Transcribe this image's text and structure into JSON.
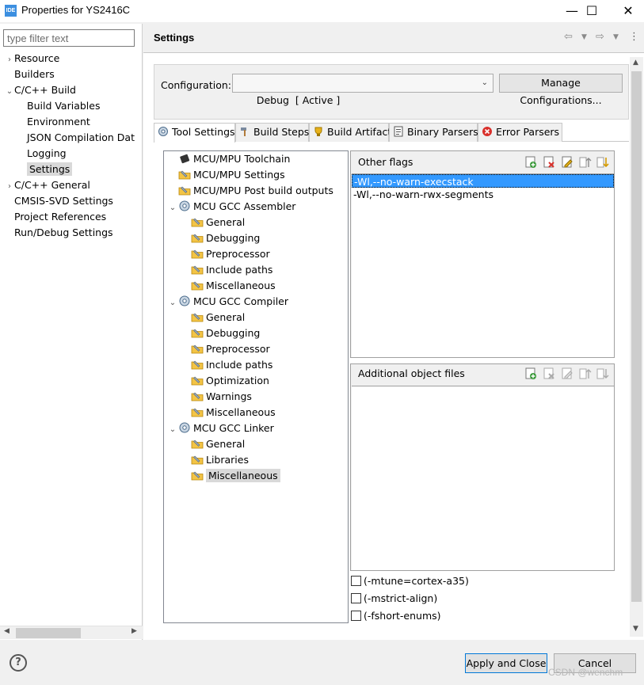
{
  "window": {
    "app_badge": "IDE",
    "title": "Properties for YS2416C",
    "minimize": "—",
    "maximize": "☐",
    "close": "✕"
  },
  "filter": {
    "placeholder": "type filter text"
  },
  "nav": {
    "items": [
      {
        "label": "Resource",
        "twist": "›",
        "level": 0
      },
      {
        "label": "Builders",
        "twist": "",
        "level": 0
      },
      {
        "label": "C/C++ Build",
        "twist": "⌄",
        "level": 0
      },
      {
        "label": "Build Variables",
        "twist": "",
        "level": 1
      },
      {
        "label": "Environment",
        "twist": "",
        "level": 1
      },
      {
        "label": "JSON Compilation Dat",
        "twist": "",
        "level": 1
      },
      {
        "label": "Logging",
        "twist": "",
        "level": 1
      },
      {
        "label": "Settings",
        "twist": "",
        "level": 1,
        "selected": true
      },
      {
        "label": "C/C++ General",
        "twist": "›",
        "level": 0
      },
      {
        "label": "CMSIS-SVD Settings",
        "twist": "",
        "level": 0
      },
      {
        "label": "Project References",
        "twist": "",
        "level": 0
      },
      {
        "label": "Run/Debug Settings",
        "twist": "",
        "level": 0
      }
    ]
  },
  "header": {
    "title": "Settings"
  },
  "config": {
    "label": "Configuration:",
    "selected": "Debug  [ Active ]",
    "manage_label": "Manage Configurations..."
  },
  "tabs": [
    {
      "label": "Tool Settings",
      "active": true
    },
    {
      "label": "Build Steps"
    },
    {
      "label": "Build Artifact"
    },
    {
      "label": "Binary Parsers"
    },
    {
      "label": "Error Parsers"
    }
  ],
  "tree": {
    "items": [
      {
        "label": "MCU/MPU Toolchain",
        "level": 0,
        "icon": "chip-icon"
      },
      {
        "label": "MCU/MPU Settings",
        "level": 0,
        "icon": "settings-folder-icon"
      },
      {
        "label": "MCU/MPU Post build outputs",
        "level": 0,
        "icon": "settings-folder-icon"
      },
      {
        "label": "MCU GCC Assembler",
        "level": 0,
        "icon": "tool-gear-icon",
        "twist": "⌄"
      },
      {
        "label": "General",
        "level": 1,
        "icon": "settings-folder-icon"
      },
      {
        "label": "Debugging",
        "level": 1,
        "icon": "settings-folder-icon"
      },
      {
        "label": "Preprocessor",
        "level": 1,
        "icon": "settings-folder-icon"
      },
      {
        "label": "Include paths",
        "level": 1,
        "icon": "settings-folder-icon"
      },
      {
        "label": "Miscellaneous",
        "level": 1,
        "icon": "settings-folder-icon"
      },
      {
        "label": "MCU GCC Compiler",
        "level": 0,
        "icon": "tool-gear-icon",
        "twist": "⌄"
      },
      {
        "label": "General",
        "level": 1,
        "icon": "settings-folder-icon"
      },
      {
        "label": "Debugging",
        "level": 1,
        "icon": "settings-folder-icon"
      },
      {
        "label": "Preprocessor",
        "level": 1,
        "icon": "settings-folder-icon"
      },
      {
        "label": "Include paths",
        "level": 1,
        "icon": "settings-folder-icon"
      },
      {
        "label": "Optimization",
        "level": 1,
        "icon": "settings-folder-icon"
      },
      {
        "label": "Warnings",
        "level": 1,
        "icon": "settings-folder-icon"
      },
      {
        "label": "Miscellaneous",
        "level": 1,
        "icon": "settings-folder-icon"
      },
      {
        "label": "MCU GCC Linker",
        "level": 0,
        "icon": "tool-gear-icon",
        "twist": "⌄"
      },
      {
        "label": "General",
        "level": 1,
        "icon": "settings-folder-icon"
      },
      {
        "label": "Libraries",
        "level": 1,
        "icon": "settings-folder-icon"
      },
      {
        "label": "Miscellaneous",
        "level": 1,
        "icon": "settings-folder-icon",
        "selected": true
      }
    ]
  },
  "other_flags": {
    "title": "Other flags",
    "items": [
      "-Wl,--no-warn-execstack",
      "-Wl,--no-warn-rwx-segments"
    ]
  },
  "object_files": {
    "title": "Additional object files",
    "items": []
  },
  "checkboxes": [
    {
      "label": "(-mtune=cortex-a35)",
      "checked": false
    },
    {
      "label": "(-mstrict-align)",
      "checked": false
    },
    {
      "label": "(-fshort-enums)",
      "checked": false
    }
  ],
  "buttons": {
    "help": "?",
    "apply_close": "Apply and Close",
    "cancel": "Cancel"
  },
  "watermark": "CSDN @wenchm",
  "colors": {
    "selection": "#3399ff",
    "accent": "#0078d7"
  }
}
